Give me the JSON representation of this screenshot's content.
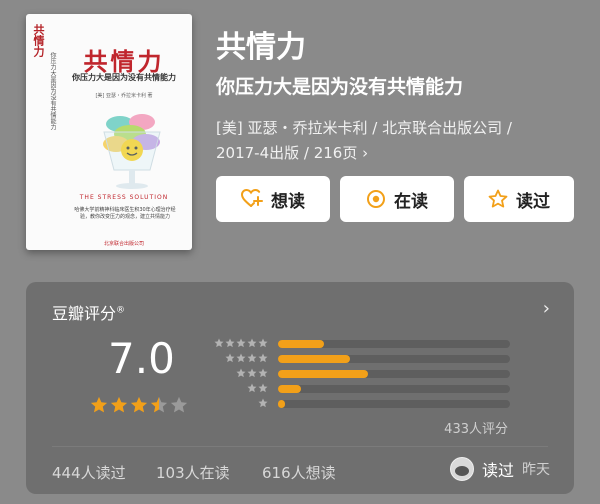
{
  "book": {
    "title": "共情力",
    "subtitle": "你压力大是因为没有共情能力",
    "meta_line1": "[美] 亚瑟・乔拉米卡利 / 北京联合出版公司 /",
    "meta_line2": "2017-4出版 / 216页",
    "meta_chevron": "›"
  },
  "cover": {
    "title": "共情力",
    "subtitle": "你压力大是因为没有共情能力",
    "spine": "共情力",
    "spine_sub": "你压力大是因为没有共情能力",
    "author": "[美] 亚瑟・乔拉米卡利 著",
    "english": "THE STRESS SOLUTION",
    "blurb": "哈佛大学前精神科临床医生积30年心理治疗经验，教你改变压力的观念，建立共情能力",
    "publisher": "北京联合出版公司"
  },
  "actions": {
    "want": "想读",
    "reading": "在读",
    "read": "读过"
  },
  "rating": {
    "title": "豆瓣评分",
    "trademark": "®",
    "score": "7.0",
    "stars_value": 3.5,
    "distribution": [
      {
        "stars": 5,
        "fraction": 0.2
      },
      {
        "stars": 4,
        "fraction": 0.31
      },
      {
        "stars": 3,
        "fraction": 0.39
      },
      {
        "stars": 2,
        "fraction": 0.1
      },
      {
        "stars": 1,
        "fraction": 0.03
      }
    ],
    "count_label": "433人评分",
    "chevron": "›"
  },
  "stats": {
    "read": "444人读过",
    "reading": "103人在读",
    "want": "616人想读"
  },
  "my_status": {
    "label": "读过",
    "time": "昨天"
  },
  "colors": {
    "accent": "#f2a019",
    "background": "#8a8a8a",
    "panel": "#6f6f6f",
    "cover_red": "#c0262d"
  }
}
